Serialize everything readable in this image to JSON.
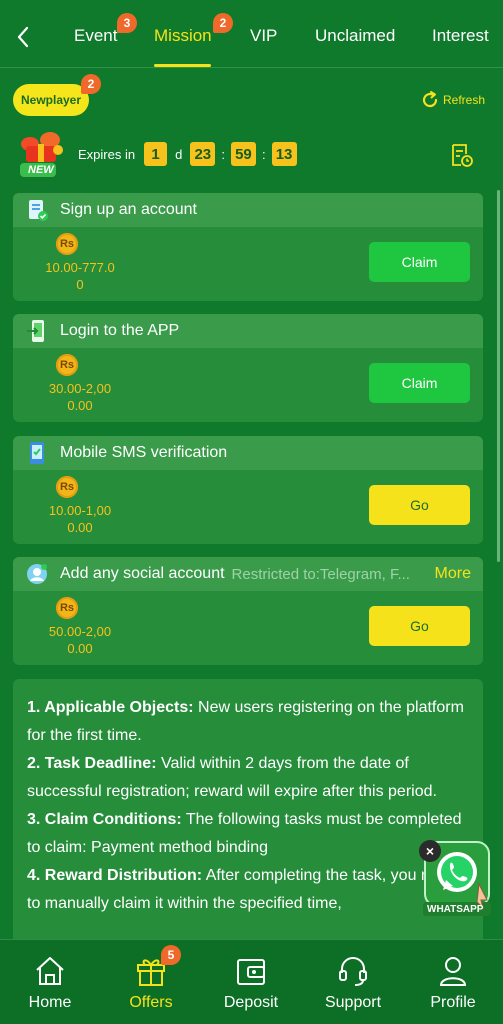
{
  "header": {
    "tabs": [
      {
        "label": "Event",
        "badge": "3"
      },
      {
        "label": "Mission",
        "badge": "2",
        "active": true
      },
      {
        "label": "VIP"
      },
      {
        "label": "Unclaimed"
      },
      {
        "label": "Interest"
      }
    ]
  },
  "level_chip": {
    "label": "Newplayer",
    "badge": "2"
  },
  "refresh_label": "Refresh",
  "expiry": {
    "prefix": "Expires in",
    "days": "1",
    "day_unit": "d",
    "hours": "23",
    "minutes": "59",
    "seconds": "13",
    "separator": ":"
  },
  "gift_badge": "NEW",
  "currency_symbol": "Rs",
  "tasks": [
    {
      "title": "Sign up an account",
      "reward_line1": "10.00-777.0",
      "reward_line2": "0",
      "action": "Claim",
      "icon": "signup-icon"
    },
    {
      "title": "Login to the APP",
      "reward_line1": "30.00-2,00",
      "reward_line2": "0.00",
      "action": "Claim",
      "icon": "login-icon"
    },
    {
      "title": "Mobile SMS verification",
      "reward_line1": "10.00-1,00",
      "reward_line2": "0.00",
      "action": "Go",
      "icon": "phone-icon"
    },
    {
      "title": "Add any social account",
      "restriction": "Restricted to:Telegram, F...",
      "more": "More",
      "reward_line1": "50.00-2,00",
      "reward_line2": "0.00",
      "action": "Go",
      "icon": "social-icon"
    }
  ],
  "rules": [
    {
      "heading": "1. Applicable Objects:",
      "text": " New users registering on the platform for the first time."
    },
    {
      "heading": "2. Task Deadline:",
      "text": " Valid within 2 days from the date of successful registration; reward will expire after this period."
    },
    {
      "heading": "3. Claim Conditions:",
      "text": " The following tasks must be completed to claim: Payment method binding"
    },
    {
      "heading": "4. Reward Distribution:",
      "text": " After completing the task, you need to manually claim it within the specified time,"
    }
  ],
  "whatsapp_label": "WHATSAPP",
  "bottom_nav": [
    {
      "label": "Home",
      "icon": "home-icon"
    },
    {
      "label": "Offers",
      "icon": "gift-icon",
      "badge": "5",
      "active": true
    },
    {
      "label": "Deposit",
      "icon": "wallet-icon"
    },
    {
      "label": "Support",
      "icon": "headset-icon"
    },
    {
      "label": "Profile",
      "icon": "user-icon"
    }
  ],
  "colors": {
    "background": "#0f7a2b",
    "accent_yellow": "#f6e21b",
    "claim_green": "#1ec73f",
    "badge_orange": "#ef6a2a"
  }
}
